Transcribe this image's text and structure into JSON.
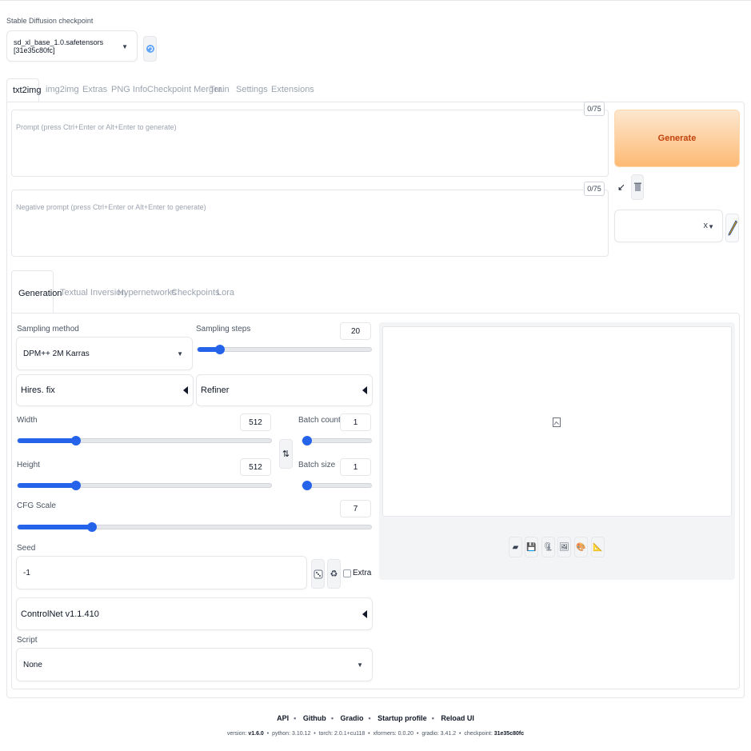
{
  "checkpoint": {
    "label": "Stable Diffusion checkpoint",
    "value": "sd_xl_base_1.0.safetensors [31e35c80fc]"
  },
  "main_tabs": [
    "txt2img",
    "img2img",
    "Extras",
    "PNG Info",
    "Checkpoint Merger",
    "Train",
    "Settings",
    "Extensions"
  ],
  "prompt": {
    "placeholder": "Prompt (press Ctrl+Enter or Alt+Enter to generate)",
    "token_count": "0/75"
  },
  "negative_prompt": {
    "placeholder": "Negative prompt (press Ctrl+Enter or Alt+Enter to generate)",
    "token_count": "0/75"
  },
  "generate_label": "Generate",
  "styles": {
    "clear_glyph": "x",
    "apply_glyph": "↙"
  },
  "sub_tabs": [
    "Generation",
    "Textual Inversion",
    "Hypernetworks",
    "Checkpoints",
    "Lora"
  ],
  "sampling_method": {
    "label": "Sampling method",
    "value": "DPM++ 2M Karras"
  },
  "sampling_steps": {
    "label": "Sampling steps",
    "value": "20",
    "fraction": 0.13
  },
  "hires_fix": {
    "label": "Hires. fix"
  },
  "refiner": {
    "label": "Refiner"
  },
  "width": {
    "label": "Width",
    "value": "512",
    "fraction": 0.23
  },
  "height": {
    "label": "Height",
    "value": "512",
    "fraction": 0.23
  },
  "batch_count": {
    "label": "Batch count",
    "value": "1",
    "fraction": 0.0
  },
  "batch_size": {
    "label": "Batch size",
    "value": "1",
    "fraction": 0.0
  },
  "cfg_scale": {
    "label": "CFG Scale",
    "value": "7",
    "fraction": 0.21
  },
  "seed": {
    "label": "Seed",
    "value": "-1",
    "extra_label": "Extra"
  },
  "controlnet": {
    "label": "ControlNet v1.1.410"
  },
  "script": {
    "label": "Script",
    "value": "None"
  },
  "output_tools": [
    "folder-icon",
    "save-icon",
    "zip-icon",
    "send-to-img2img-icon",
    "send-to-inpaint-icon",
    "send-to-extras-icon"
  ],
  "footer": {
    "links": [
      "API",
      "Github",
      "Gradio",
      "Startup profile",
      "Reload UI"
    ],
    "version_prefix": "version: ",
    "version": "v1.6.0",
    "python_prefix": "python: ",
    "python": "3.10.12",
    "torch_prefix": "torch: ",
    "torch": "2.0.1+cu118",
    "xformers_prefix": "xformers: ",
    "xformers": "0.0.20",
    "gradio_prefix": "gradio: ",
    "gradio": "3.41.2",
    "checkpoint_prefix": "checkpoint: ",
    "checkpoint": "31e35c80fc"
  },
  "colors": {
    "accent": "#2563eb",
    "generate_bg_start": "#fde3c6",
    "generate_bg_end": "#fdba74",
    "generate_text": "#c2410c"
  }
}
